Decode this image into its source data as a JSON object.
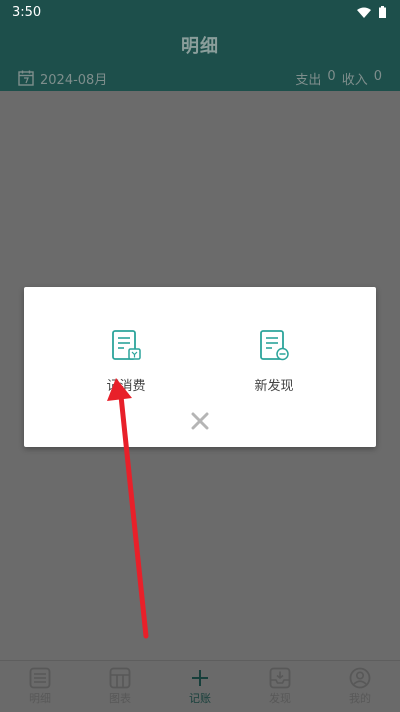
{
  "status_bar": {
    "time": "3:50"
  },
  "header": {
    "title": "明细",
    "date": "2024-08月",
    "expense_label": "支出",
    "expense_value": "0",
    "income_label": "收入",
    "income_value": "0"
  },
  "dialog": {
    "options": [
      {
        "label": "记消费",
        "icon": "note-add-icon"
      },
      {
        "label": "新发现",
        "icon": "note-discover-icon"
      }
    ],
    "close_icon": "close-icon"
  },
  "bottom_nav": [
    {
      "label": "明细",
      "icon": "list-icon"
    },
    {
      "label": "图表",
      "icon": "grid-icon"
    },
    {
      "label": "记账",
      "icon": "plus-icon"
    },
    {
      "label": "发现",
      "icon": "inbox-icon"
    },
    {
      "label": "我的",
      "icon": "user-icon"
    }
  ],
  "colors": {
    "accent": "#2ca49b",
    "header_dim": "#1d4f4b",
    "annotation_arrow": "#e8202a"
  }
}
